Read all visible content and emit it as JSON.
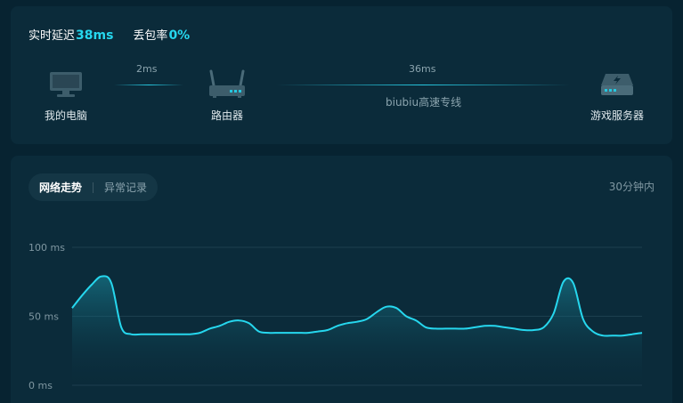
{
  "stats": {
    "latency_label": "实时延迟",
    "latency_value": "38ms",
    "loss_label": "丢包率",
    "loss_value": "0%"
  },
  "route": {
    "nodes": [
      {
        "label": "我的电脑",
        "icon": "monitor-icon"
      },
      {
        "label": "路由器",
        "icon": "router-icon"
      },
      {
        "label": "游戏服务器",
        "icon": "server-icon"
      }
    ],
    "links": [
      {
        "latency": "2ms"
      },
      {
        "latency": "36ms",
        "label": "biubiu高速专线"
      }
    ]
  },
  "trend": {
    "tabs": [
      {
        "label": "网络走势",
        "active": true
      },
      {
        "label": "异常记录",
        "active": false
      }
    ],
    "time_range": "30分钟内"
  },
  "colors": {
    "accent": "#26d7ee",
    "background": "#072331",
    "card": "#0b2b3a"
  },
  "chart_data": {
    "type": "area",
    "ylim": [
      0,
      100
    ],
    "yticks": [
      "100 ms",
      "50 ms",
      "0 ms"
    ],
    "series": [
      {
        "values": [
          56,
          65,
          73,
          79,
          74,
          42,
          37,
          37,
          37,
          37,
          37,
          37,
          37,
          38,
          41,
          43,
          46,
          47,
          45,
          39,
          38,
          38,
          38,
          38,
          38,
          39,
          40,
          43,
          45,
          46,
          48,
          53,
          57,
          56,
          50,
          47,
          42,
          41,
          41,
          41,
          41,
          42,
          43,
          43,
          42,
          41,
          40,
          40,
          42,
          52,
          75,
          74,
          48,
          39,
          36,
          36,
          36,
          37,
          38
        ]
      }
    ]
  }
}
